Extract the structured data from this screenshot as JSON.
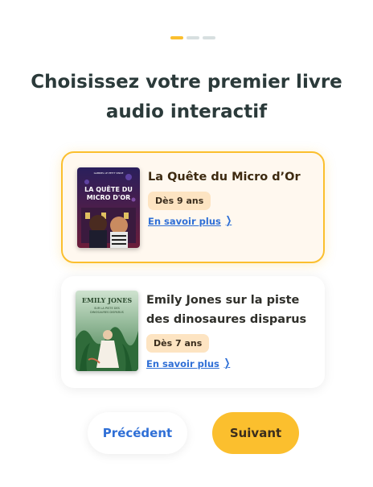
{
  "progress": {
    "total_steps": 3,
    "current_step": 1
  },
  "title": "Choisissez votre premier livre audio interactif",
  "books": [
    {
      "title": "La Quête du Micro d’Or",
      "age": "Dès 9 ans",
      "learn_more": "En savoir plus",
      "selected": true,
      "cover": {
        "line1": "LA QUÊTE DU",
        "line2": "MICRO D'OR",
        "top_text": "GABRIEL LE PETIT VINCE"
      }
    },
    {
      "title": "Emily Jones sur la piste des dinosaures disparus",
      "age": "Dès 7 ans",
      "learn_more": "En savoir plus",
      "selected": false,
      "cover": {
        "line1": "EMILY JONES",
        "line2": "SUR LA PISTE DES",
        "line3": "DINOSAURES DISPARUS"
      }
    }
  ],
  "buttons": {
    "previous": "Précédent",
    "next": "Suivant"
  },
  "colors": {
    "accent": "#fbbf2e",
    "link": "#2f6fd6",
    "selected_bg": "#fff8ef",
    "age_badge": "#fde4c2"
  }
}
